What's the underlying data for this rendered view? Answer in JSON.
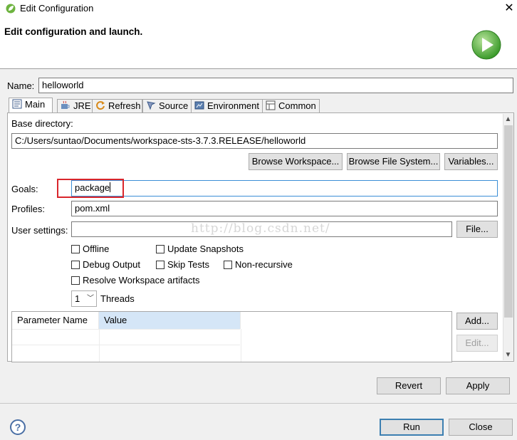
{
  "window": {
    "title": "Edit Configuration",
    "close_glyph": "✕"
  },
  "banner": {
    "heading": "Edit configuration and launch.",
    "icon": "run-play-icon"
  },
  "name": {
    "label": "Name:",
    "value": "helloworld"
  },
  "tabs": [
    {
      "label": "Main",
      "icon": "main-tab-icon",
      "active": true
    },
    {
      "label": "JRE",
      "icon": "jre-icon"
    },
    {
      "label": "Refresh",
      "icon": "refresh-icon"
    },
    {
      "label": "Source",
      "icon": "source-icon"
    },
    {
      "label": "Environment",
      "icon": "environment-icon"
    },
    {
      "label": "Common",
      "icon": "common-icon"
    }
  ],
  "main": {
    "base_directory_label": "Base directory:",
    "base_directory_value": "C:/Users/suntao/Documents/workspace-sts-3.7.3.RELEASE/helloworld",
    "browse_workspace": "Browse Workspace...",
    "browse_file_system": "Browse File System...",
    "variables": "Variables...",
    "goals_label": "Goals:",
    "goals_value": "package",
    "profiles_label": "Profiles:",
    "profiles_value": "pom.xml",
    "user_settings_label": "User settings:",
    "user_settings_value": "",
    "file_button": "File...",
    "watermark": "http://blog.csdn.net/",
    "checkboxes": {
      "offline": "Offline",
      "update_snapshots": "Update Snapshots",
      "debug_output": "Debug Output",
      "skip_tests": "Skip Tests",
      "non_recursive": "Non-recursive",
      "resolve_workspace": "Resolve Workspace artifacts"
    },
    "threads_value": "1",
    "threads_label": "Threads",
    "table": {
      "col_name": "Parameter Name",
      "col_value": "Value"
    },
    "add_button": "Add...",
    "edit_button": "Edit..."
  },
  "actions": {
    "revert": "Revert",
    "apply": "Apply",
    "run": "Run",
    "close": "Close",
    "help_glyph": "?"
  },
  "colors": {
    "highlight": "#d9262c",
    "focus": "#3b8ed6",
    "selected_header": "#d5e6f7"
  }
}
